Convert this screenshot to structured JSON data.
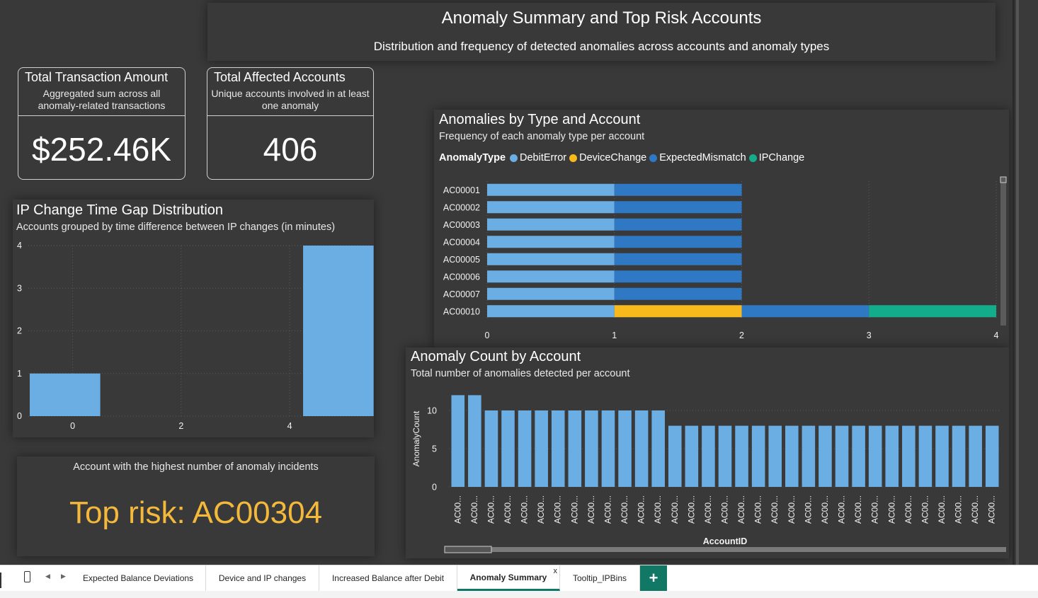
{
  "header": {
    "title": "Anomaly Summary and Top Risk Accounts",
    "subtitle": "Distribution and frequency of detected anomalies across accounts and anomaly types"
  },
  "cards": [
    {
      "title": "Total Transaction Amount",
      "subtitle": "Aggregated sum across all anomaly-related transactions",
      "value": "$252.46K"
    },
    {
      "title": "Total Affected Accounts",
      "subtitle": "Unique accounts involved in at least one anomaly",
      "value": "406"
    }
  ],
  "ipgap": {
    "title": "IP Change Time Gap Distribution",
    "subtitle": "Accounts grouped by time difference between IP changes (in minutes)"
  },
  "toprisk": {
    "subtitle": "Account with the highest number of anomaly incidents",
    "value": "Top risk: AC00304"
  },
  "anomtype": {
    "title": "Anomalies by Type and Account",
    "subtitle": "Frequency of each anomaly type per account",
    "legend_title": "AnomalyType"
  },
  "anomcount": {
    "title": "Anomaly Count by Account",
    "subtitle": "Total number of anomalies detected per account"
  },
  "colors": {
    "DebitError": "#6aaee3",
    "DeviceChange": "#f8b91c",
    "ExpectedMismatch": "#2f79c4",
    "IPChange": "#13ad8b",
    "bar": "#6aaee3",
    "accent": "#117865",
    "toprisk": "#f4b93a"
  },
  "chart_data": [
    {
      "type": "bar",
      "orientation": "vertical",
      "x": [
        0,
        4
      ],
      "values": [
        1,
        4
      ],
      "x_ticks": [
        0,
        2,
        4
      ],
      "y_ticks": [
        0,
        1,
        2,
        3,
        4
      ],
      "ylim": [
        0,
        4
      ],
      "grid": true
    },
    {
      "type": "bar",
      "orientation": "horizontal",
      "stacked": true,
      "categories": [
        "AC00001",
        "AC00002",
        "AC00003",
        "AC00004",
        "AC00005",
        "AC00006",
        "AC00007",
        "AC00010"
      ],
      "series": [
        {
          "name": "DebitError",
          "values": [
            1,
            1,
            1,
            1,
            1,
            1,
            1,
            1
          ]
        },
        {
          "name": "DeviceChange",
          "values": [
            0,
            0,
            0,
            0,
            0,
            0,
            0,
            1
          ]
        },
        {
          "name": "ExpectedMismatch",
          "values": [
            1,
            1,
            1,
            1,
            1,
            1,
            1,
            1
          ]
        },
        {
          "name": "IPChange",
          "values": [
            0,
            0,
            0,
            0,
            0,
            0,
            0,
            1
          ]
        }
      ],
      "x_ticks": [
        0,
        1,
        2,
        3,
        4
      ],
      "xlim": [
        0,
        4
      ],
      "legend_position": "top-left",
      "grid": true
    },
    {
      "type": "bar",
      "orientation": "vertical",
      "categories": [
        "AC00...",
        "AC00...",
        "AC00...",
        "AC00...",
        "AC00...",
        "AC00...",
        "AC00...",
        "AC00...",
        "AC00...",
        "AC00...",
        "AC00...",
        "AC00...",
        "AC00...",
        "AC00...",
        "AC00...",
        "AC00...",
        "AC00...",
        "AC00...",
        "AC00...",
        "AC00...",
        "AC00...",
        "AC00...",
        "AC00...",
        "AC00...",
        "AC00...",
        "AC00...",
        "AC00...",
        "AC00...",
        "AC00...",
        "AC00...",
        "AC00...",
        "AC00...",
        "AC00..."
      ],
      "values": [
        12,
        12,
        10,
        10,
        10,
        10,
        10,
        10,
        10,
        10,
        10,
        10,
        10,
        8,
        8,
        8,
        8,
        8,
        8,
        8,
        8,
        8,
        8,
        8,
        8,
        8,
        8,
        8,
        8,
        8,
        8,
        8,
        8
      ],
      "xlabel": "AccountID",
      "ylabel": "AnomalyCount",
      "y_ticks": [
        0,
        5,
        10
      ],
      "ylim": [
        0,
        12.5
      ],
      "grid": true
    }
  ],
  "tabs": {
    "items": [
      "Expected Balance Deviations",
      "Device and IP changes",
      "Increased Balance after Debit",
      "Anomaly Summary",
      "Tooltip_IPBins"
    ],
    "active": "Anomaly Summary",
    "close": "x",
    "add": "+"
  }
}
